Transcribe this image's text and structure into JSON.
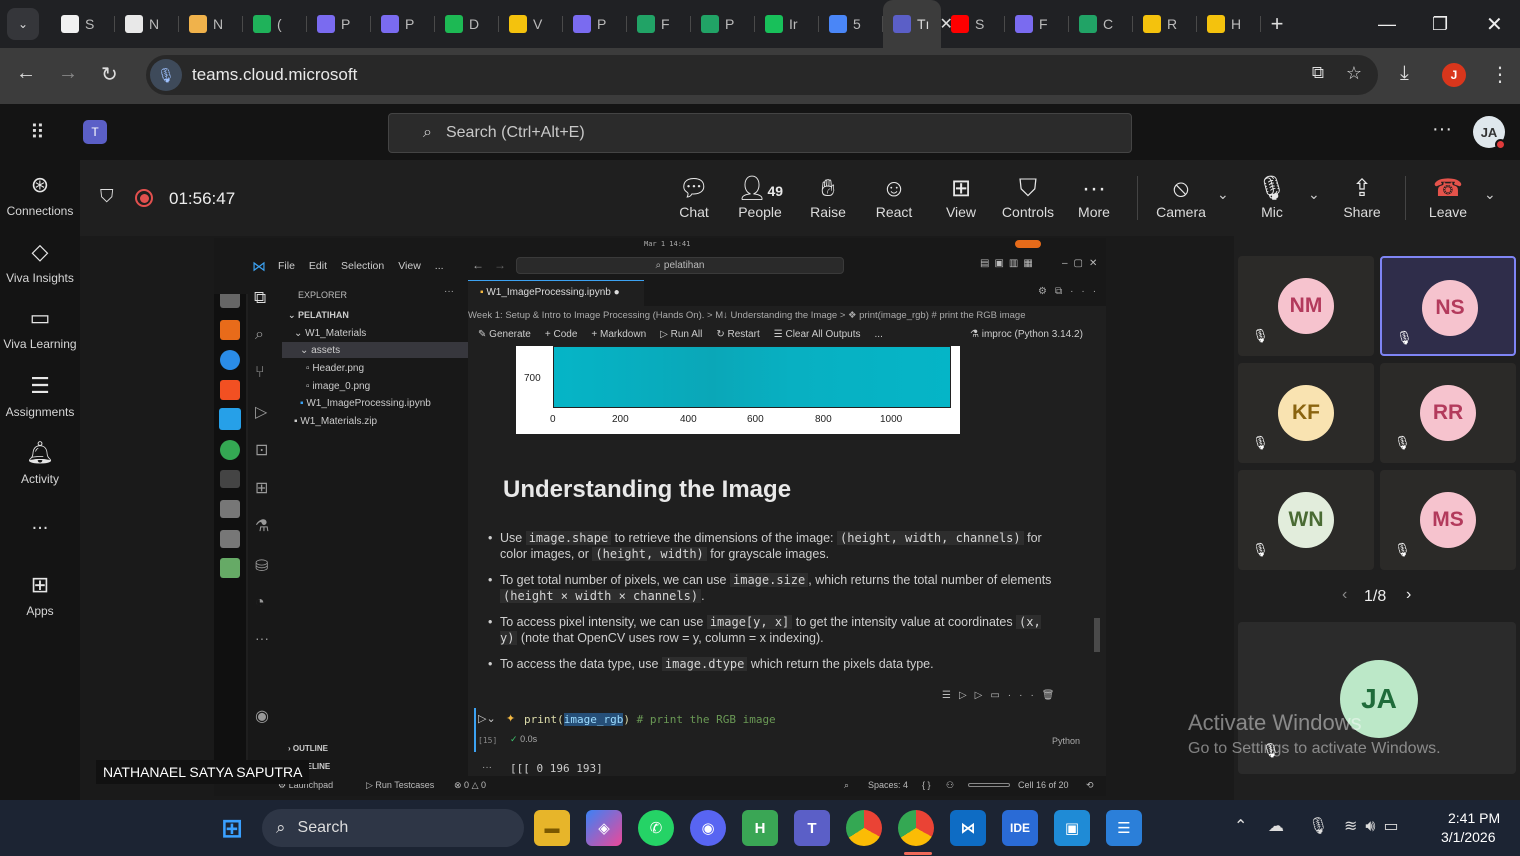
{
  "browser": {
    "tabs": [
      {
        "label": "S",
        "color": "#f1f1f1"
      },
      {
        "label": "N",
        "color": "#e8e8e8"
      },
      {
        "label": "N",
        "color": "#f0b24b"
      },
      {
        "label": "(",
        "color": "#1fb25a"
      },
      {
        "label": "P",
        "color": "#7a6bf0"
      },
      {
        "label": "P",
        "color": "#7a6bf0"
      },
      {
        "label": "D",
        "color": "#1db954"
      },
      {
        "label": "V",
        "color": "#f4c20d"
      },
      {
        "label": "P",
        "color": "#7a6bf0"
      },
      {
        "label": "F",
        "color": "#21a366"
      },
      {
        "label": "P",
        "color": "#21a366"
      },
      {
        "label": "Ir",
        "color": "#18c05a"
      },
      {
        "label": "5",
        "color": "#4a86f7"
      },
      {
        "label": "Tı",
        "color": "#5b5fc7",
        "active": true
      },
      {
        "label": "S",
        "color": "#ff0000"
      },
      {
        "label": "F",
        "color": "#7a6bf0"
      },
      {
        "label": "C",
        "color": "#21a366"
      },
      {
        "label": "R",
        "color": "#f4c20d"
      },
      {
        "label": "H",
        "color": "#f4c20d"
      }
    ],
    "url": "teams.cloud.microsoft",
    "profile_initial": "J"
  },
  "teams": {
    "search_placeholder": "Search (Ctrl+Alt+E)",
    "user_initials": "JA",
    "rail": [
      "Connections",
      "Viva Insights",
      "Viva Learning",
      "Assignments",
      "Activity",
      "...",
      "Apps"
    ],
    "timer": "01:56:47",
    "controls": {
      "chat": "Chat",
      "people": "People",
      "people_count": "49",
      "raise": "Raise",
      "react": "React",
      "view": "View",
      "controls": "Controls",
      "more": "More",
      "camera": "Camera",
      "mic": "Mic",
      "share": "Share",
      "leave": "Leave"
    },
    "presenter": "NATHANAEL SATYA SAPUTRA",
    "participants": [
      {
        "initials": "NM",
        "color": "#f6c3ce",
        "text": "#b33a5c"
      },
      {
        "initials": "NS",
        "color": "#f6c3ce",
        "text": "#b33a5c"
      },
      {
        "initials": "KF",
        "color": "#f9e3b1",
        "text": "#8a6410"
      },
      {
        "initials": "RR",
        "color": "#f6c3ce",
        "text": "#b33a5c"
      },
      {
        "initials": "WN",
        "color": "#e2eddc",
        "text": "#4a6b34"
      },
      {
        "initials": "MS",
        "color": "#f6c3ce",
        "text": "#b33a5c"
      }
    ],
    "pager": "1/8",
    "self_initials": "JA",
    "watermark_title": "Activate Windows",
    "watermark_sub": "Go to Settings to activate Windows."
  },
  "vscode": {
    "menu": [
      "File",
      "Edit",
      "Selection",
      "View",
      "..."
    ],
    "search": "pelatihan",
    "date": "Mar 1 14:41",
    "explorer_title": "EXPLORER",
    "tree": [
      "PELATIHAN",
      "W1_Materials",
      "assets",
      "Header.png",
      "image_0.png",
      "W1_ImageProcessing.ipynb",
      "W1_Materials.zip"
    ],
    "outline": "OUTLINE",
    "timeline": "TIMELINE",
    "tab_file": "W1_ImageProcessing.ipynb",
    "breadcrumb": "Week 1: Setup & Intro to Image Processing (Hands On). > M↓ Understanding the Image > ❖ print(image_rgb) # print the RGB image",
    "toolbar": [
      "Generate",
      "+ Code",
      "+ Markdown",
      "Run All",
      "Restart",
      "Clear All Outputs",
      "..."
    ],
    "kernel": "improc (Python 3.14.2)",
    "plot_ytick": "700",
    "plot_xticks": [
      "0",
      "200",
      "400",
      "600",
      "800",
      "1000"
    ],
    "heading": "Understanding the Image",
    "bullets": [
      {
        "pre": "Use ",
        "c1": "image.shape",
        "mid": " to retrieve the dimensions of the image: ",
        "c2": "(height, width, channels)",
        "mid2": " for color images, or ",
        "c3": "(height, width)",
        "post": " for grayscale images."
      },
      {
        "pre": "To get total number of pixels, we can use ",
        "c1": "image.size",
        "mid": ", which returns the total number of elements ",
        "c2": "(height × width × channels)",
        "post": "."
      },
      {
        "pre": "To access pixel intensity, we can use ",
        "c1": "image[y, x]",
        "mid": " to get the intensity value at coordinates ",
        "c2": "(x, y)",
        "post": " (note that OpenCV uses row = y, column = x indexing)."
      },
      {
        "pre": "To access the data type, use ",
        "c1": "image.dtype",
        "post": " which return the pixels data type."
      }
    ],
    "code_fn": "print(",
    "code_sel": "image_rgb",
    "code_close": ")",
    "code_comment": "# print the RGB image",
    "exec_count": "[15]",
    "exec_time": "0.0s",
    "lang": "Python",
    "output": "[[[  0 196 193]",
    "status": {
      "launchpad": "Launchpad",
      "run": "Run Testcases",
      "errors": "0",
      "warnings": "0",
      "spaces": "Spaces: 4",
      "cell": "Cell 16 of 20"
    }
  },
  "taskbar": {
    "search": "Search",
    "time": "2:41 PM",
    "date": "3/1/2026"
  }
}
